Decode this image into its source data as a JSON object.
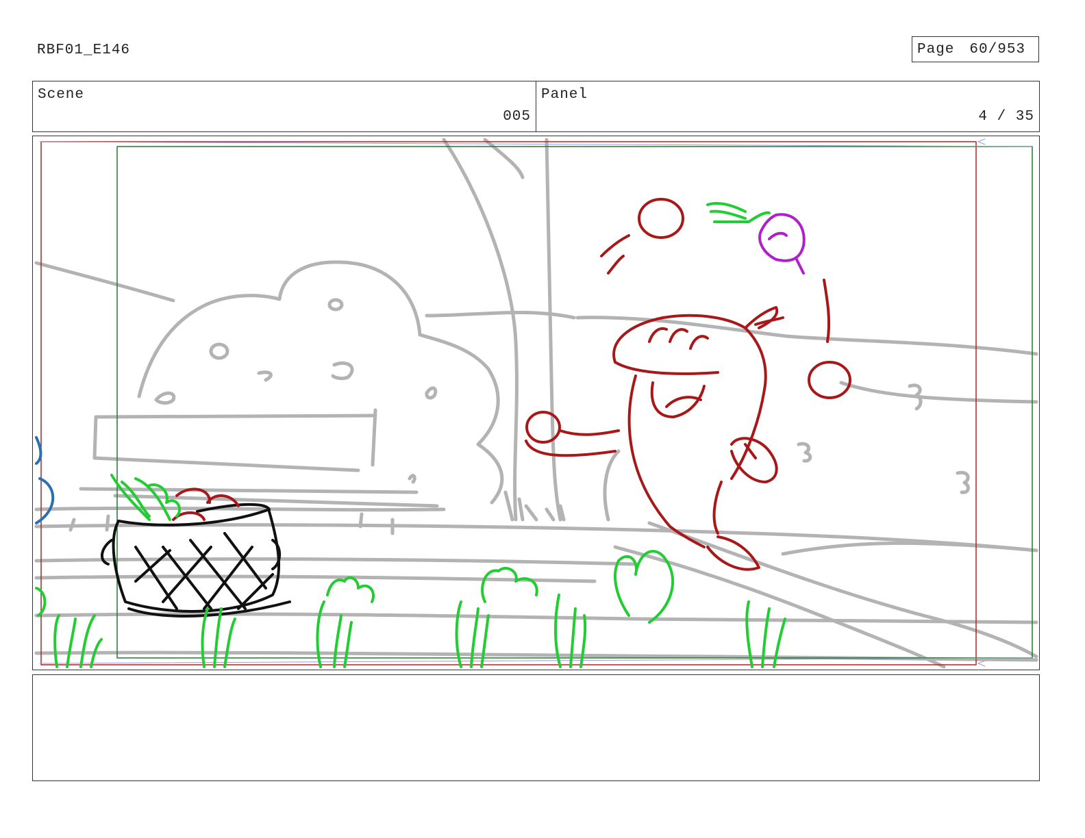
{
  "header": {
    "document_id": "RBF01_E146",
    "page_label": "Page",
    "page_value": "60/953"
  },
  "info": {
    "scene_label": "Scene",
    "scene_value": "005",
    "panel_label": "Panel",
    "panel_value": "4 / 35"
  },
  "panel": {
    "safe_frame_color": "#b22222",
    "title_safe_color": "#1e7b2e",
    "sketch_colors": {
      "background": "#b3b3b3",
      "character": "#a81818",
      "plants": "#22cc33",
      "radish": "#b020c8",
      "basket": "#111111",
      "offscreen": "#2a6fb0"
    }
  },
  "notes": {
    "text": ""
  }
}
